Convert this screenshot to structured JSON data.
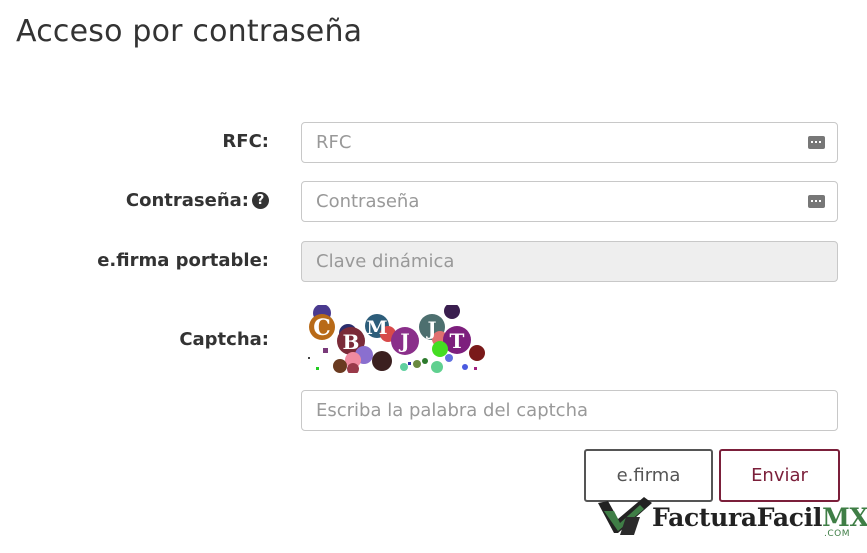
{
  "header": {
    "title": "Acceso por contraseña"
  },
  "form": {
    "rfc": {
      "label": "RFC:",
      "placeholder": "RFC"
    },
    "password": {
      "label": "Contraseña:",
      "placeholder": "Contraseña",
      "help_icon": "question-circle-icon"
    },
    "portable": {
      "label": "e.firma portable:",
      "placeholder": "Clave dinámica"
    },
    "captcha": {
      "label": "Captcha:",
      "code": "CBMJJT",
      "input_placeholder": "Escriba la palabra del captcha"
    }
  },
  "buttons": {
    "efirma": "e.firma",
    "enviar": "Enviar"
  },
  "logo": {
    "name": "FacturaFacil",
    "suffix": "MX",
    "domain": ".COM"
  },
  "colors": {
    "accent": "#7b1f3a",
    "brand_green": "#3f7e46",
    "text": "#333333"
  }
}
